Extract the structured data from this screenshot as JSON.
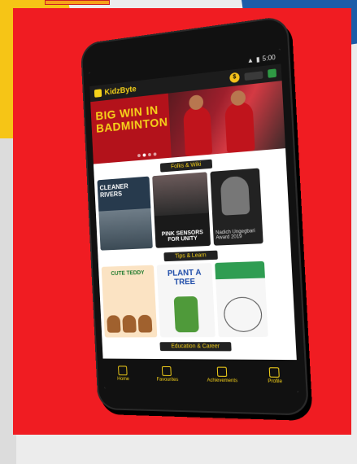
{
  "app": {
    "name": "KidzByte",
    "status_time": "5:00"
  },
  "banner": {
    "title_line1": "BIG WIN IN",
    "title_line2": "BADMINTON"
  },
  "sections": [
    {
      "title": "Folks & Wiki",
      "cards": [
        {
          "label": "CLEANER RIVERS"
        },
        {
          "label": "PINK SENSORS FOR UNITY"
        },
        {
          "label": "Nadich Ungegbari Award 2019"
        }
      ]
    },
    {
      "title": "Tips & Learn",
      "cards": [
        {
          "label": "CUTE TEDDY"
        },
        {
          "label": "PLANT A TREE"
        },
        {
          "label": ""
        }
      ]
    },
    {
      "title": "Education & Career"
    }
  ],
  "nav": [
    {
      "label": "Home",
      "icon": "home-icon"
    },
    {
      "label": "Favourites",
      "icon": "bookmark-icon"
    },
    {
      "label": "Achievements",
      "icon": "trophy-icon"
    },
    {
      "label": "Profile",
      "icon": "profile-icon"
    }
  ],
  "colors": {
    "accent": "#f6d21a",
    "background_red": "#f01c22",
    "dark": "#111111"
  }
}
